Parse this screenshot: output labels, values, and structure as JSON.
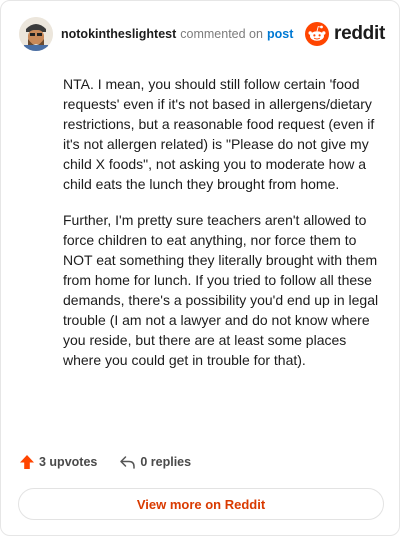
{
  "header": {
    "username": "notokintheslightest",
    "commented_text": "commented on",
    "post_link": "post",
    "brand": "reddit"
  },
  "comment": {
    "paragraphs": [
      "NTA. I mean, you should still follow certain 'food requests' even if it's not based in allergens/dietary restrictions, but a reasonable food request (even if it's not allergen related) is \"Please do not give my child X foods\", not asking you to moderate how a child eats the lunch they brought from home.",
      "Further, I'm pretty sure teachers aren't allowed to force children to eat anything, nor force them to NOT eat something they literally brought with them from home for lunch. If you tried to follow all these demands, there's a possibility you'd end up in legal trouble (I am not a lawyer and do not know where you reside, but there are at least some places where you could get in trouble for that)."
    ]
  },
  "actions": {
    "upvotes": "3 upvotes",
    "replies": "0 replies"
  },
  "footer": {
    "view_more": "View more on Reddit"
  },
  "colors": {
    "upvote": "#ff4500",
    "link": "#0079d3",
    "view_more": "#d93a00",
    "reddit_logo": "#ff4500"
  },
  "icons": {
    "avatar": "user-avatar",
    "logo": "reddit-snoo-icon",
    "upvote": "upvote-arrow-icon",
    "reply": "reply-arrow-icon"
  }
}
